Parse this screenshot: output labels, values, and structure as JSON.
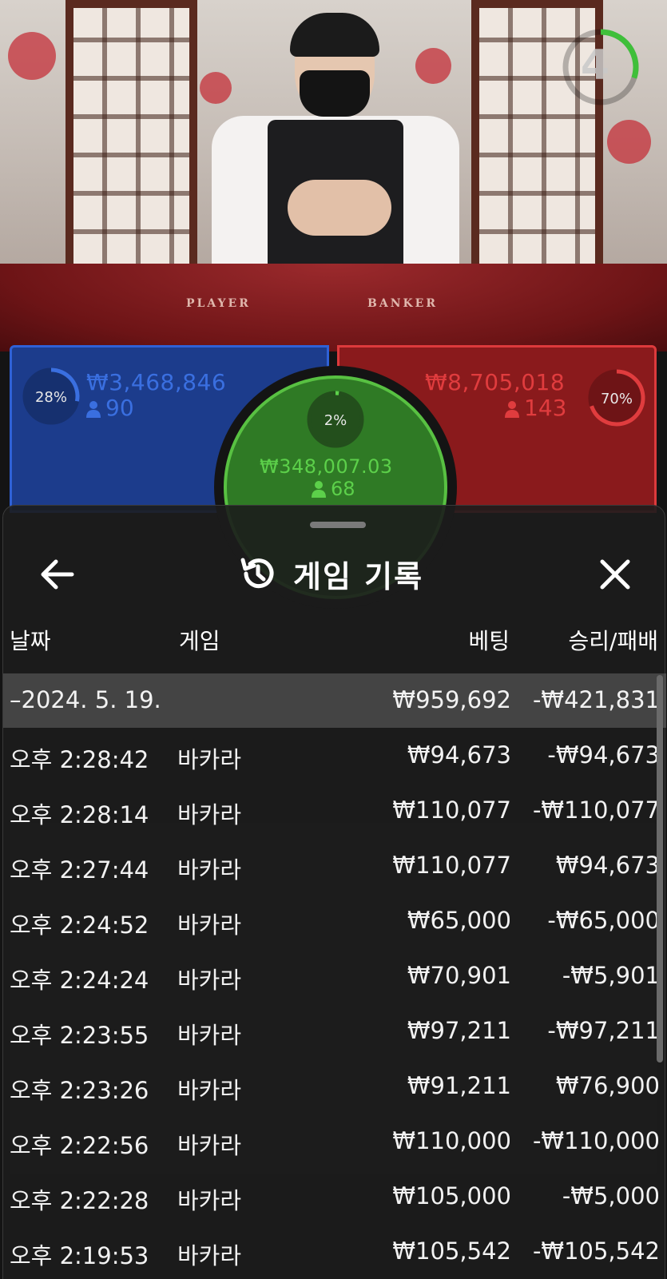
{
  "video": {
    "countdown": "4",
    "felt_labels": [
      "PLAYER",
      "BANKER"
    ]
  },
  "bets": {
    "player": {
      "percent": "28%",
      "percent_value": 28,
      "amount": "₩3,468,846",
      "count": "90",
      "color": "#1c3c8c"
    },
    "tie": {
      "percent": "2%",
      "percent_value": 2,
      "amount": "₩348,007.03",
      "count": "68",
      "color": "#2f7a25"
    },
    "banker": {
      "percent": "70%",
      "percent_value": 70,
      "amount": "₩8,705,018",
      "count": "143",
      "color": "#8a1a1c"
    }
  },
  "sheet": {
    "title": "게임 기록",
    "back_icon": "arrow-left-icon",
    "title_icon": "history-icon",
    "close_icon": "close-icon",
    "columns": {
      "date": "날짜",
      "game": "게임",
      "bet": "베팅",
      "result": "승리/패배"
    },
    "summary": {
      "date": "–2024. 5. 19.",
      "bet": "₩959,692",
      "result": "-₩421,831"
    },
    "rows": [
      {
        "time": "오후 2:28:42",
        "game": "바카라",
        "bet": "₩94,673",
        "result": "-₩94,673"
      },
      {
        "time": "오후 2:28:14",
        "game": "바카라",
        "bet": "₩110,077",
        "result": "-₩110,077"
      },
      {
        "time": "오후 2:27:44",
        "game": "바카라",
        "bet": "₩110,077",
        "result": "₩94,673"
      },
      {
        "time": "오후 2:24:52",
        "game": "바카라",
        "bet": "₩65,000",
        "result": "-₩65,000"
      },
      {
        "time": "오후 2:24:24",
        "game": "바카라",
        "bet": "₩70,901",
        "result": "-₩5,901"
      },
      {
        "time": "오후 2:23:55",
        "game": "바카라",
        "bet": "₩97,211",
        "result": "-₩97,211"
      },
      {
        "time": "오후 2:23:26",
        "game": "바카라",
        "bet": "₩91,211",
        "result": "₩76,900"
      },
      {
        "time": "오후 2:22:56",
        "game": "바카라",
        "bet": "₩110,000",
        "result": "-₩110,000"
      },
      {
        "time": "오후 2:22:28",
        "game": "바카라",
        "bet": "₩105,000",
        "result": "-₩5,000"
      },
      {
        "time": "오후 2:19:53",
        "game": "바카라",
        "bet": "₩105,542",
        "result": "-₩105,542"
      }
    ]
  },
  "colors": {
    "player": "#3a6fe0",
    "banker": "#e03c3e",
    "tie": "#5cd04a",
    "sheet_bg": "#1c1c1c"
  }
}
